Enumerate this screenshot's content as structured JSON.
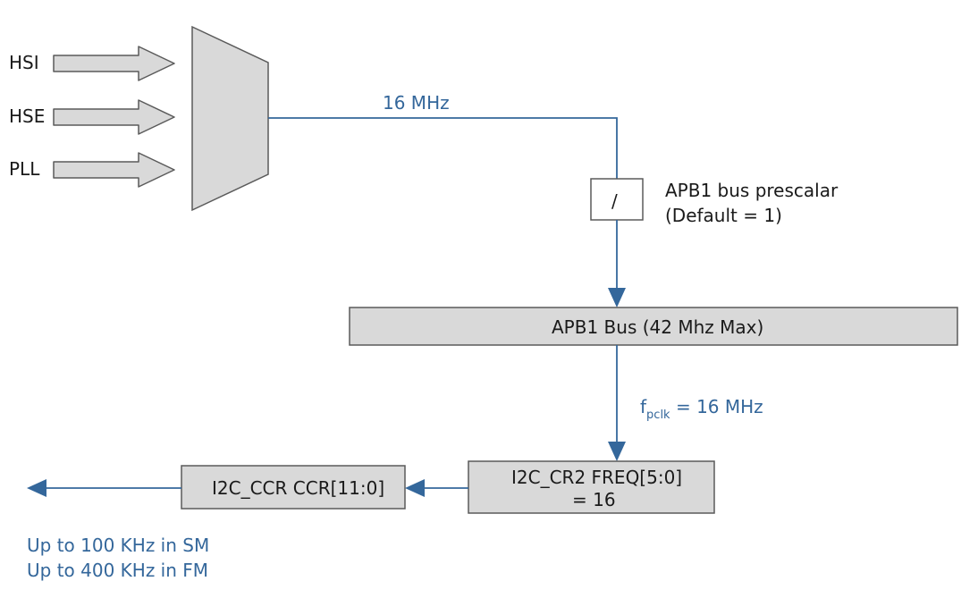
{
  "sources": {
    "hsi": "HSI",
    "hse": "HSE",
    "pll": "PLL"
  },
  "mux_output_freq": "16 MHz",
  "prescaler": {
    "symbol": "/",
    "label_line1": "APB1 bus prescalar",
    "label_line2": "(Default = 1)"
  },
  "apb1_bus": "APB1 Bus (42 Mhz Max)",
  "pclk": {
    "prefix": "f",
    "sub": "pclk",
    "suffix": " = 16 MHz"
  },
  "cr2": {
    "line1": "I2C_CR2 FREQ[5:0]",
    "line2": "= 16"
  },
  "ccr": "I2C_CCR CCR[11:0]",
  "output_note": {
    "line1": "Up to 100 KHz in SM",
    "line2": "Up to 400 KHz in FM"
  }
}
